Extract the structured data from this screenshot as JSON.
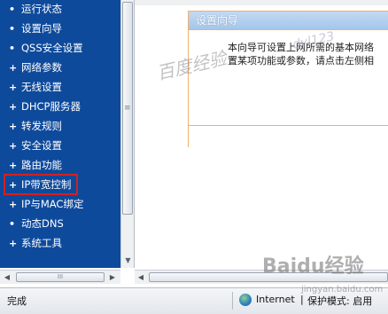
{
  "nav": {
    "items": [
      {
        "label": "运行状态",
        "bullet": "•"
      },
      {
        "label": "设置向导",
        "bullet": "•"
      },
      {
        "label": "QSS安全设置",
        "bullet": "•"
      },
      {
        "label": "网络参数",
        "bullet": "+"
      },
      {
        "label": "无线设置",
        "bullet": "+"
      },
      {
        "label": "DHCP服务器",
        "bullet": "+"
      },
      {
        "label": "转发规则",
        "bullet": "+"
      },
      {
        "label": "安全设置",
        "bullet": "+"
      },
      {
        "label": "路由功能",
        "bullet": "+"
      },
      {
        "label": "IP带宽控制",
        "bullet": "+"
      },
      {
        "label": "IP与MAC绑定",
        "bullet": "+"
      },
      {
        "label": "动态DNS",
        "bullet": "•"
      },
      {
        "label": "系统工具",
        "bullet": "+"
      }
    ],
    "highlighted_index": 9,
    "grip": "≡",
    "hgrip": "III"
  },
  "wizard": {
    "title": "设置向导",
    "line1": "本向导可设置上网所需的基本网络",
    "line2": "置某项功能或参数，请点击左侧相"
  },
  "watermarks": {
    "text": "百度经验",
    "handle": "dyl123",
    "logo": "Baidu经验",
    "url": "jingyan.baidu.com"
  },
  "status": {
    "text": "完成",
    "zone": "Internet",
    "divider": "|",
    "mode": "保护模式: 启用"
  },
  "colors": {
    "nav_bg": "#0e4a9c",
    "wizard_header": "#b3d0ee",
    "wizard_border": "#f0b070",
    "highlight": "#d42020"
  }
}
